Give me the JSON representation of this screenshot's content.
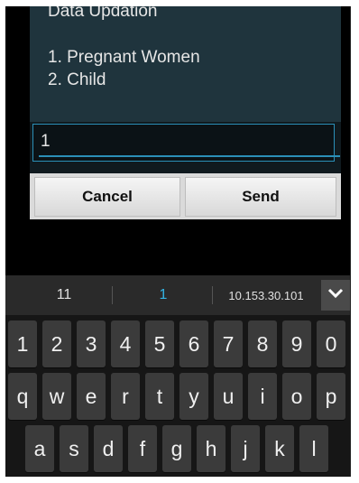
{
  "dialog": {
    "title_partial": "Data Updation",
    "options": [
      "1. Pregnant Women",
      "2. Child"
    ],
    "input_value": "1",
    "cancel_label": "Cancel",
    "send_label": "Send"
  },
  "keyboard": {
    "suggestions": [
      "11",
      "1",
      "10.153.30.101"
    ],
    "number_row": [
      "1",
      "2",
      "3",
      "4",
      "5",
      "6",
      "7",
      "8",
      "9",
      "0"
    ],
    "row1": [
      "q",
      "w",
      "e",
      "r",
      "t",
      "y",
      "u",
      "i",
      "o",
      "p"
    ],
    "row2": [
      "a",
      "s",
      "d",
      "f",
      "g",
      "h",
      "j",
      "k",
      "l"
    ],
    "expand_icon": "chevron-down-icon"
  },
  "colors": {
    "dialog_bg": "#1f343d",
    "accent": "#2b8fb8",
    "highlight_suggestion": "#33b5e5"
  }
}
